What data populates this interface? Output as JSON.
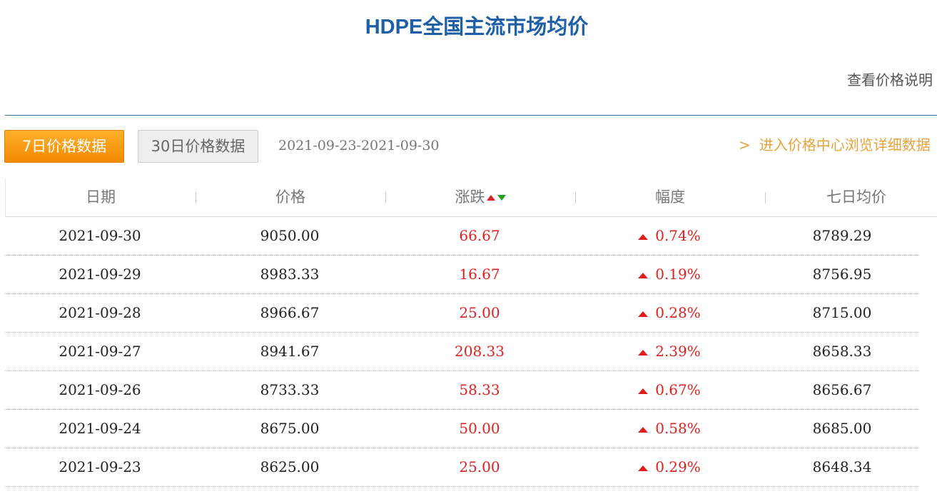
{
  "page": {
    "title": "HDPE全国主流市场均价",
    "price_note_link": "查看价格说明"
  },
  "tabs": {
    "seven_day": "7日价格数据",
    "thirty_day": "30日价格数据"
  },
  "date_range": "2021-09-23-2021-09-30",
  "center_link": {
    "chevron": ">",
    "label": "进入价格中心浏览详细数据"
  },
  "table": {
    "headers": {
      "date": "日期",
      "price": "价格",
      "change": "涨跌",
      "range": "幅度",
      "avg7": "七日均价"
    },
    "rows": [
      {
        "date": "2021-09-30",
        "price": "9050.00",
        "change": "66.67",
        "pct": "0.74%",
        "avg7": "8789.29",
        "direction": "up"
      },
      {
        "date": "2021-09-29",
        "price": "8983.33",
        "change": "16.67",
        "pct": "0.19%",
        "avg7": "8756.95",
        "direction": "up"
      },
      {
        "date": "2021-09-28",
        "price": "8966.67",
        "change": "25.00",
        "pct": "0.28%",
        "avg7": "8715.00",
        "direction": "up"
      },
      {
        "date": "2021-09-27",
        "price": "8941.67",
        "change": "208.33",
        "pct": "2.39%",
        "avg7": "8658.33",
        "direction": "up"
      },
      {
        "date": "2021-09-26",
        "price": "8733.33",
        "change": "58.33",
        "pct": "0.67%",
        "avg7": "8656.67",
        "direction": "up"
      },
      {
        "date": "2021-09-24",
        "price": "8675.00",
        "change": "50.00",
        "pct": "0.58%",
        "avg7": "8685.00",
        "direction": "up"
      },
      {
        "date": "2021-09-23",
        "price": "8625.00",
        "change": "25.00",
        "pct": "0.29%",
        "avg7": "8648.34",
        "direction": "up"
      }
    ]
  },
  "colors": {
    "title": "#1f5fa8",
    "accent_orange": "#f28a00",
    "rise_red": "#e02020",
    "fall_green": "#20a020",
    "link_orange": "#e8a33c"
  }
}
